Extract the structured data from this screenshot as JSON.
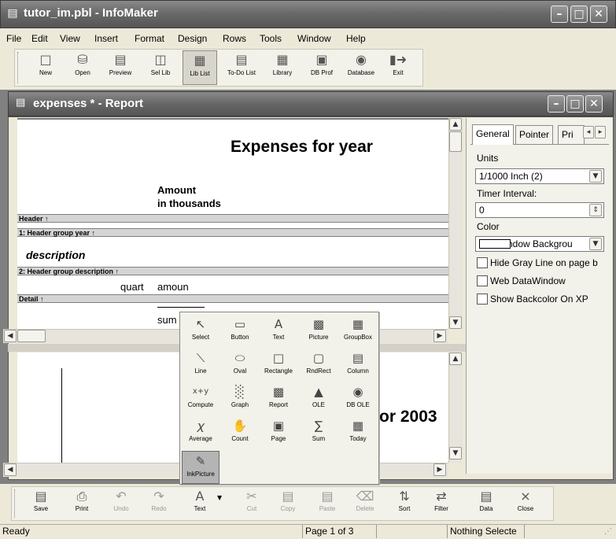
{
  "app": {
    "title": "tutor_im.pbl - InfoMaker",
    "icon": "app-window-icon",
    "controls": [
      "minimize",
      "maximize",
      "close"
    ]
  },
  "menu": [
    "File",
    "Edit",
    "View",
    "Insert",
    "Format",
    "Design",
    "Rows",
    "Tools",
    "Window",
    "Help"
  ],
  "toolbar": [
    {
      "label": "New",
      "icon": "new-icon"
    },
    {
      "label": "Open",
      "icon": "open-folder-icon"
    },
    {
      "label": "Preview",
      "icon": "preview-icon"
    },
    {
      "label": "Sel Lib",
      "icon": "select-library-icon"
    },
    {
      "label": "Lib List",
      "icon": "library-list-icon",
      "active": true
    },
    {
      "label": "To-Do List",
      "icon": "todo-list-icon"
    },
    {
      "label": "Library",
      "icon": "library-icon"
    },
    {
      "label": "DB Prof",
      "icon": "db-profile-icon"
    },
    {
      "label": "Database",
      "icon": "database-icon"
    },
    {
      "label": "Exit",
      "icon": "exit-icon"
    }
  ],
  "report_window": {
    "title": "expenses * - Report",
    "icon": "report-window-icon"
  },
  "design": {
    "report_title": "Expenses for  year",
    "amount_line1": "Amount",
    "amount_line2": "in thousands",
    "bands": {
      "header": "Header ↑",
      "group1": "1: Header group year ↑",
      "group2": "2: Header group description ↑",
      "detail": "Detail ↑"
    },
    "description": "description",
    "quart": "quart",
    "amount_field": "amoun",
    "sum_field": "sum"
  },
  "preview": {
    "text": "or  2003"
  },
  "properties": {
    "tabs": [
      "General",
      "Pointer",
      "Pri"
    ],
    "active_tab": "General",
    "units_label": "Units",
    "units_value": "1/1000 Inch (2)",
    "timer_label": "Timer Interval:",
    "timer_value": "0",
    "color_label": "Color",
    "color_value": "Window Backgrou",
    "checkboxes": [
      "Hide Gray Line on page b",
      "Web DataWindow",
      "Show Backcolor On XP"
    ]
  },
  "palette": [
    {
      "label": "Select",
      "icon": "select-arrow-icon"
    },
    {
      "label": "Button",
      "icon": "button-icon"
    },
    {
      "label": "Text",
      "icon": "text-a-icon"
    },
    {
      "label": "Picture",
      "icon": "picture-icon"
    },
    {
      "label": "GroupBox",
      "icon": "groupbox-icon"
    },
    {
      "label": "Line",
      "icon": "line-icon"
    },
    {
      "label": "Oval",
      "icon": "oval-icon"
    },
    {
      "label": "Rectangle",
      "icon": "rectangle-icon"
    },
    {
      "label": "RndRect",
      "icon": "round-rectangle-icon"
    },
    {
      "label": "Column",
      "icon": "column-icon"
    },
    {
      "label": "Compute",
      "icon": "compute-icon"
    },
    {
      "label": "Graph",
      "icon": "graph-icon"
    },
    {
      "label": "Report",
      "icon": "report-icon"
    },
    {
      "label": "OLE",
      "icon": "ole-icon"
    },
    {
      "label": "DB OLE",
      "icon": "db-ole-icon"
    },
    {
      "label": "Average",
      "icon": "average-icon"
    },
    {
      "label": "Count",
      "icon": "count-icon"
    },
    {
      "label": "Page",
      "icon": "page-icon"
    },
    {
      "label": "Sum",
      "icon": "sum-icon"
    },
    {
      "label": "Today",
      "icon": "today-icon"
    },
    {
      "label": "InkPicture",
      "icon": "ink-picture-icon",
      "selected": true
    }
  ],
  "bottom_toolbar": [
    {
      "label": "Save",
      "icon": "save-icon",
      "enabled": true
    },
    {
      "label": "Print",
      "icon": "print-icon",
      "enabled": true
    },
    {
      "label": "Undo",
      "icon": "undo-icon",
      "enabled": false
    },
    {
      "label": "Redo",
      "icon": "redo-icon",
      "enabled": false
    },
    {
      "label": "Text",
      "icon": "text-icon",
      "enabled": true
    },
    {
      "label": "Cut",
      "icon": "cut-icon",
      "enabled": false
    },
    {
      "label": "Copy",
      "icon": "copy-icon",
      "enabled": false
    },
    {
      "label": "Paste",
      "icon": "paste-icon",
      "enabled": false
    },
    {
      "label": "Delete",
      "icon": "delete-icon",
      "enabled": false
    },
    {
      "label": "Sort",
      "icon": "sort-icon",
      "enabled": true
    },
    {
      "label": "Filter",
      "icon": "filter-icon",
      "enabled": true
    },
    {
      "label": "Data",
      "icon": "data-icon",
      "enabled": true
    },
    {
      "label": "Close",
      "icon": "close-x-icon",
      "enabled": true
    }
  ],
  "status": {
    "ready": "Ready",
    "page": "Page 1 of 3",
    "selection": "Nothing Selecte"
  }
}
